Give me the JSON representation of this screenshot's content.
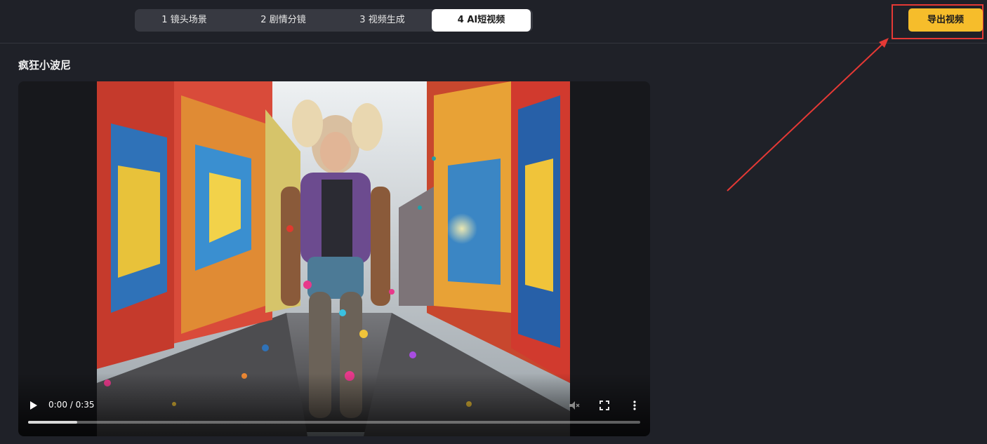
{
  "steps": [
    {
      "label": "1 镜头场景",
      "active": false
    },
    {
      "label": "2 剧情分镜",
      "active": false
    },
    {
      "label": "3 视频生成",
      "active": false
    },
    {
      "label": "4 AI短视频",
      "active": true
    }
  ],
  "export_button": {
    "label": "导出视频",
    "color": "#f6bd2b"
  },
  "annotation": {
    "color": "#e53935"
  },
  "video": {
    "title": "疯狂小波尼",
    "time_display": "0:00 / 0:35",
    "progress": 0.08,
    "controls": {
      "play_icon": "play-icon",
      "volume_icon": "volume-muted-icon",
      "fullscreen_icon": "fullscreen-icon",
      "more_icon": "more-vertical-icon"
    }
  },
  "colors": {
    "background": "#1f2128",
    "tab_bar": "#373941",
    "tab_active": "#ffffff"
  }
}
